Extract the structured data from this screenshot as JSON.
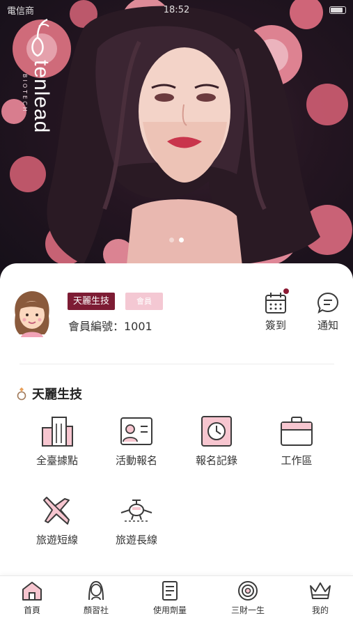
{
  "status_bar": {
    "carrier": "電信商",
    "time": "18:52"
  },
  "hero": {
    "brand_name": "tenlead",
    "brand_sub": "BIOTECH",
    "carousel_pages": 2,
    "active_page": 2
  },
  "profile": {
    "tag_company": "天麗生技",
    "tag_role": "會員",
    "member_number": "會員編號：1001"
  },
  "actions": {
    "checkin_label": "簽到",
    "notify_label": "通知"
  },
  "section": {
    "title": "天麗生技",
    "items": [
      {
        "label": "全臺據點",
        "icon": "building-icon"
      },
      {
        "label": "活動報名",
        "icon": "id-card-icon"
      },
      {
        "label": "報名記錄",
        "icon": "clock-icon"
      },
      {
        "label": "工作區",
        "icon": "briefcase-icon"
      },
      {
        "label": "旅遊短線",
        "icon": "airplane-icon"
      },
      {
        "label": "旅遊長線",
        "icon": "plane-front-icon"
      }
    ]
  },
  "tabbar": {
    "items": [
      {
        "label": "首頁",
        "icon": "home-icon"
      },
      {
        "label": "顏習社",
        "icon": "woman-icon"
      },
      {
        "label": "使用劑量",
        "icon": "document-icon"
      },
      {
        "label": "三財一生",
        "icon": "target-icon"
      },
      {
        "label": "我的",
        "icon": "crown-icon"
      }
    ]
  },
  "colors": {
    "accent": "#7d1c34",
    "accent_light": "#f4c8d3",
    "icon_fill": "#f7c6d0",
    "icon_stroke": "#3a3a3a"
  }
}
